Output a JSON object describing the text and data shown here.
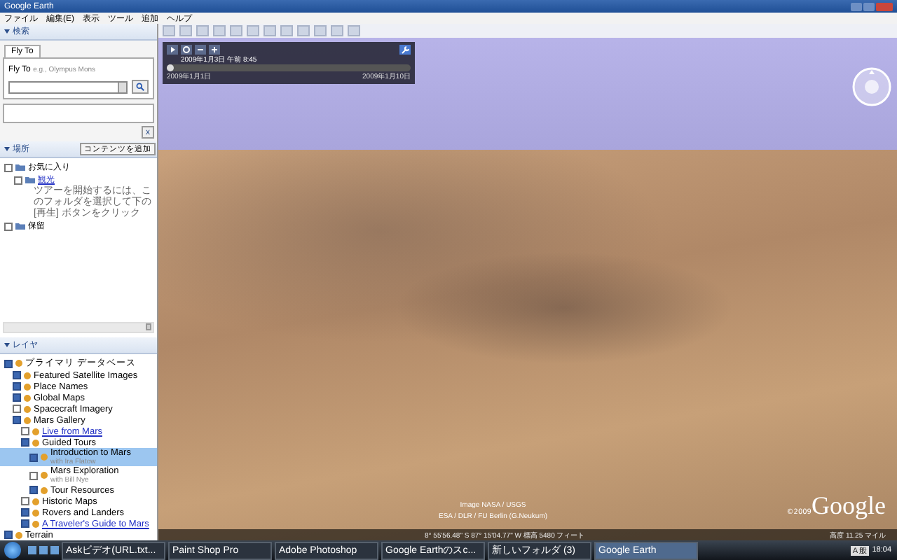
{
  "window": {
    "title": "Google Earth"
  },
  "menu": [
    "ファイル",
    "編集(E)",
    "表示",
    "ツール",
    "追加",
    "ヘルプ"
  ],
  "search": {
    "header": "検索",
    "tab": "Fly To",
    "prompt": "Fly To",
    "example": "e.g., Olympus Mons",
    "close": "x"
  },
  "places": {
    "header": "場所",
    "add_button": "コンテンツを追加",
    "items": [
      {
        "label": "お気に入り",
        "checked": false,
        "link": false,
        "children": [
          {
            "label": "観光",
            "checked": false,
            "link": true,
            "note": "ツアーを開始するには、このフォルダを選択して下の [再生] ボタンをクリック"
          }
        ]
      },
      {
        "label": "保留",
        "checked": false,
        "link": false
      }
    ]
  },
  "layers": {
    "header": "レイヤ",
    "items": [
      {
        "label": "プライマリ データベース",
        "checked": true,
        "selected": false,
        "link": false,
        "children": [
          {
            "label": "Featured Satellite Images",
            "checked": true,
            "selected": false,
            "link": false
          },
          {
            "label": "Place Names",
            "checked": true,
            "selected": false,
            "link": false
          },
          {
            "label": "Global Maps",
            "checked": true,
            "selected": false,
            "link": false
          },
          {
            "label": "Spacecraft Imagery",
            "checked": false,
            "selected": false,
            "link": false
          },
          {
            "label": "Mars Gallery",
            "checked": true,
            "selected": false,
            "link": false,
            "children": [
              {
                "label": "Live from Mars",
                "checked": false,
                "selected": false,
                "link": true
              },
              {
                "label": "Guided Tours",
                "checked": true,
                "selected": false,
                "link": false,
                "children": [
                  {
                    "label": "Introduction to Mars",
                    "checked": true,
                    "selected": true,
                    "link": false,
                    "sub": "with Ira Flatow"
                  },
                  {
                    "label": "Mars Exploration",
                    "checked": false,
                    "selected": false,
                    "link": false,
                    "sub": "with Bill Nye"
                  },
                  {
                    "label": "Tour Resources",
                    "checked": true,
                    "selected": false,
                    "link": false
                  }
                ]
              },
              {
                "label": "Historic Maps",
                "checked": false,
                "selected": false,
                "link": false
              },
              {
                "label": "Rovers and Landers",
                "checked": true,
                "selected": false,
                "link": false
              },
              {
                "label": "A Traveler's Guide to Mars",
                "checked": true,
                "selected": false,
                "link": true
              }
            ]
          }
        ]
      },
      {
        "label": "Terrain",
        "checked": true,
        "selected": false,
        "link": false
      }
    ]
  },
  "time_slider": {
    "current": "2009年1月3日 午前 8:45",
    "start": "2009年1月1日",
    "end": "2009年1月10日",
    "level": 0.03
  },
  "attribution": [
    "Image NASA / USGS",
    "ESA / DLR / FU Berlin (G.Neukum)"
  ],
  "logo": {
    "copyright": "©2009",
    "name": "Google"
  },
  "status_bar": {
    "coordinates": "8° 55'56.48\" S   87° 15'04.77\" W   標高  5480 フィート",
    "altitude": "高度  11.25 マイル"
  },
  "taskbar": {
    "tasks": [
      {
        "label": "Askビデオ(URL.txt...",
        "selected": false
      },
      {
        "label": "Paint Shop Pro",
        "selected": false
      },
      {
        "label": "Adobe Photoshop",
        "selected": false
      },
      {
        "label": "Google Earthのスc...",
        "selected": false
      },
      {
        "label": "新しいフォルダ (3)",
        "selected": false
      },
      {
        "label": "Google Earth",
        "selected": true
      }
    ],
    "ime": "A 般",
    "clock": "18:04"
  }
}
